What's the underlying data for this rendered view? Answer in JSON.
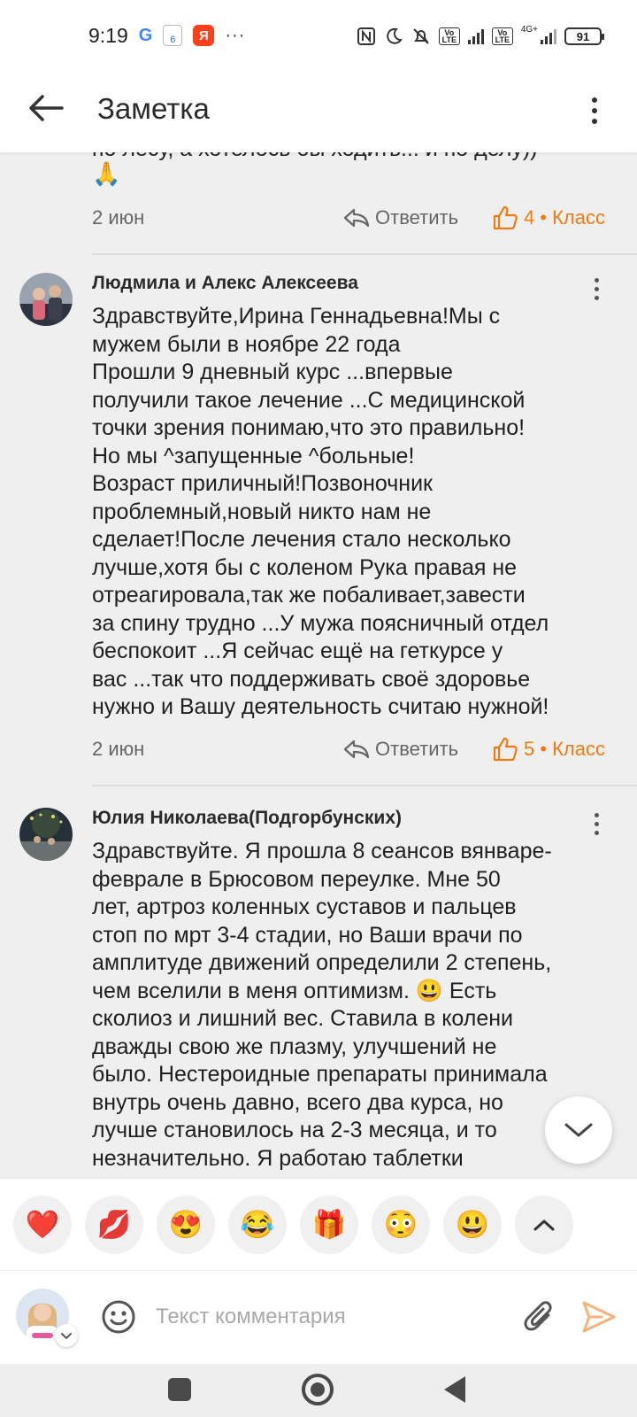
{
  "status_bar": {
    "time": "9:19",
    "google_glyph": "G",
    "calendar_day": "6",
    "yandex_glyph": "Я",
    "more_glyph": "···",
    "volte_top": "Vo",
    "volte_bottom": "LTE",
    "network": "4G+",
    "battery": "91",
    "icons": [
      "nfc-icon",
      "moon-icon",
      "mute-icon",
      "volte-icon",
      "signal-icon",
      "battery-icon"
    ]
  },
  "app_bar": {
    "title": "Заметка"
  },
  "previous_comment": {
    "text_partial": "по лесу, а хотелось бы ходить!!! и по делу))",
    "emoji": "🙏",
    "date": "2 июн",
    "reply_label": "Ответить",
    "likes": "4",
    "like_label": "• Класс"
  },
  "comments": [
    {
      "author": "Людмила и Алекс Алексеева",
      "text": "Здравствуйте,Ирина Геннадьевна!Мы с\nмужем были в ноябре 22 года\nПрошли 9 дневный курс ...впервые\nполучили такое лечение ...С медицинской\nточки зрения понимаю,что это правильно!\nНо мы ^запущенные ^больные!\nВозраст приличный!Позвоночник\nпроблемный,новый никто нам не\nсделает!После лечения стало несколько\nлучше,хотя бы с коленом Рука правая не\nотреагировала,так же побаливает,завести\nза спину трудно ...У мужа поясничный отдел\nбеспокоит ...Я сейчас ещё на геткурсе у\nвас ...так что поддерживать своё здоровье\nнужно и Вашу деятельность считаю нужной!",
      "date": "2 июн",
      "reply_label": "Ответить",
      "likes": "5",
      "like_label": "• Класс"
    },
    {
      "author": "Юлия Николаева(Подгорбунских)",
      "text": "Здравствуйте. Я прошла 8 сеансов вянваре-\nфеврале в Брюсовом переулке. Мне 50\nлет, артроз коленных суставов и пальцев\nстоп по мрт 3-4 стадии, но Ваши врачи по\nамплитуде движений определили 2 степень,\nчем вселили в меня оптимизм. 😃 Есть\nсколиоз и лишний вес. Ставила в колени\nдважды свою же плазму, улучшений не\nбыло. Нестероидные препараты принимала\nвнутрь очень давно, всего два курса, но\nлучше становилось на 2-3 месяца, и то\nнезначительно. Я работаю таблетки"
    }
  ],
  "reactions": [
    {
      "emoji": "❤️",
      "icon": "heart-icon"
    },
    {
      "emoji": "💋",
      "icon": "kiss-icon"
    },
    {
      "emoji": "😍",
      "icon": "heart-eyes-icon"
    },
    {
      "emoji": "😂",
      "icon": "laugh-icon"
    },
    {
      "emoji": "🎁",
      "icon": "gift-icon"
    },
    {
      "emoji": "😳",
      "icon": "flushed-icon"
    },
    {
      "emoji": "😃",
      "icon": "smile-icon"
    }
  ],
  "comment_input": {
    "placeholder": "Текст комментария"
  },
  "colors": {
    "accent": "#f07a13",
    "background": "#efefef",
    "send_icon": "#f5b27a"
  }
}
